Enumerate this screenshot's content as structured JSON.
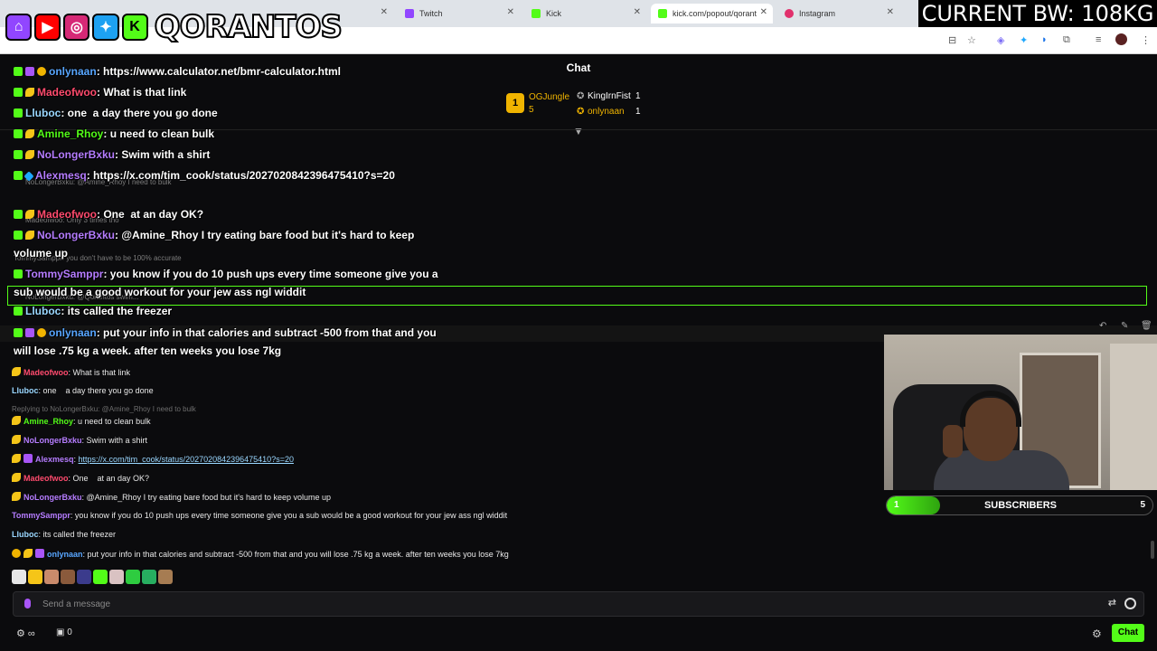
{
  "browser": {
    "tabs": [
      {
        "label": "",
        "icon": "generic-tab-icon"
      },
      {
        "label": "Twitch",
        "icon": "twitch-icon"
      },
      {
        "label": "Kick",
        "icon": "kick-icon"
      },
      {
        "label": "kick.com/popout/qorant",
        "icon": "kick-icon"
      },
      {
        "label": "Instagram",
        "icon": "instagram-icon"
      }
    ]
  },
  "overlay": {
    "brand": "QORANTOS",
    "bw_banner": "CURRENT BW: 108KG"
  },
  "chat": {
    "title": "Chat",
    "top_gifters": [
      {
        "name": "OGJungle",
        "count": "5"
      },
      {
        "name": "KingIrnFist",
        "count": "1"
      },
      {
        "name": "onlynaan",
        "count": "1"
      }
    ],
    "rank_badge": "1",
    "input_placeholder": "Send a message",
    "points_icon": "∞",
    "gift_count": "0",
    "chat_button": "Chat"
  },
  "overlay_messages": [
    {
      "user": "onlynaan",
      "color": "#58a6ff",
      "text": ": https://www.calculator.net/bmr-calculator.html"
    },
    {
      "user": "Madeofwoo",
      "color": "#ff4b6e",
      "text": ": What is that link"
    },
    {
      "user": "Lluboc",
      "color": "#9ad7ff",
      "text": ": one  a day there you go done"
    },
    {
      "user": "Amine_Rhoy",
      "color": "#53fc18",
      "text": ": u need to clean bulk"
    },
    {
      "user": "NoLongerBxku",
      "color": "#b57cff",
      "text": ": Swim with a shirt"
    },
    {
      "user": "Alexmesq",
      "color": "#b57cff",
      "text": ": https://x.com/tim_cook/status/2027020842396475410?s=20"
    },
    {
      "user": "Madeofwoo",
      "color": "#ff4b6e",
      "text": ": One  at an day OK?"
    },
    {
      "user": "NoLongerBxku",
      "color": "#b57cff",
      "text": ": @Amine_Rhoy I try eating bare food but it's hard to keep volume up"
    },
    {
      "user": "TommySamppr",
      "color": "#b57cff",
      "text": ": you know if you do 10 push ups every time someone give you a sub would be a good workout for your jew ass ngl widdit"
    },
    {
      "user": "Lluboc",
      "color": "#9ad7ff",
      "text": ": its called the freezer"
    },
    {
      "user": "onlynaan",
      "color": "#58a6ff",
      "text": ": put your info in that calories and subtract -500 from that and you will lose .75 kg a week. after ten weeks you lose 7kg"
    }
  ],
  "ghost_messages": [
    "NoLongerBxku: @Amine_Rhoy I need to bulk",
    "Madeofwoo: Only 3 times tho",
    "TommySamppr: you don't have to be 100% accurate",
    "NoLongerBxku: @Qorantos swim..."
  ],
  "messages": [
    {
      "user": "Madeofwoo",
      "color": "#ff4b6e",
      "text": ": What is that link"
    },
    {
      "user": "Lluboc",
      "color": "#9ad7ff",
      "text": ": one    a day there you go done"
    },
    {
      "reply": "Replying to NoLongerBxku: @Amine_Rhoy I need to bulk"
    },
    {
      "user": "Amine_Rhoy",
      "color": "#53fc18",
      "text": ": u need to clean bulk"
    },
    {
      "user": "NoLongerBxku",
      "color": "#b57cff",
      "text": ": Swim with a shirt"
    },
    {
      "user": "Alexmesq",
      "color": "#b57cff",
      "text": ": ",
      "link": "https://x.com/tim_cook/status/2027020842396475410?s=20"
    },
    {
      "user": "Madeofwoo",
      "color": "#ff4b6e",
      "text": ": One    at an day OK?"
    },
    {
      "user": "NoLongerBxku",
      "color": "#b57cff",
      "text": ": @Amine_Rhoy I try eating bare food but it's hard to keep volume up"
    },
    {
      "user": "TommySamppr",
      "color": "#b57cff",
      "text": ": you know if you do 10 push ups every time someone give you a sub would be a good workout for your jew ass ngl widdit"
    },
    {
      "user": "Lluboc",
      "color": "#9ad7ff",
      "text": ": its called the freezer"
    },
    {
      "user": "onlynaan",
      "color": "#58a6ff",
      "text": ": put your info in that calories and subtract -500 from that and you will lose .75 kg a week. after ten weeks you lose 7kg"
    }
  ],
  "subscribers": {
    "label": "SUBSCRIBERS",
    "current": "1",
    "goal": "5",
    "progress": 0.2
  },
  "colors": {
    "kick_green": "#53fc18",
    "gold": "#f0b400"
  }
}
